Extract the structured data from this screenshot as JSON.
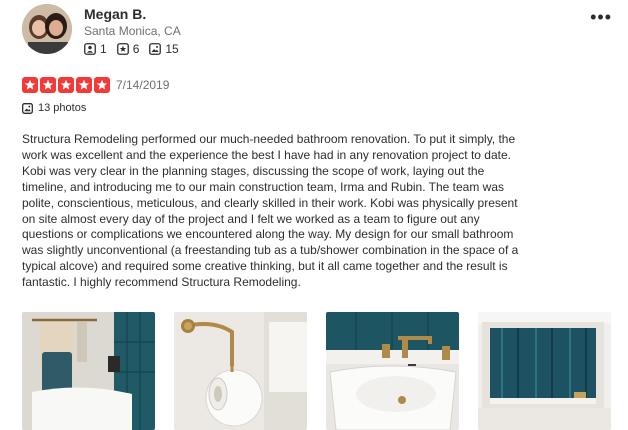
{
  "user": {
    "name": "Megan B.",
    "location": "Santa Monica, CA",
    "stats": {
      "friends": "1",
      "reviews": "6",
      "photos": "15"
    }
  },
  "review": {
    "rating": 5,
    "date": "7/14/2019",
    "photos_label": "13 photos",
    "text": "Structura Remodeling performed our much-needed bathroom renovation.  To put it simply, the work was excellent and the experience the best I have had in any renovation project to date.  Kobi was very clear in the planning stages, discussing the scope of work, laying out the timeline, and introducing me to our main construction team, Irma and Rubin.  The team was polite, conscientious, meticulous, and clearly skilled in their work.  Kobi was physically present on site almost every day of the project and I felt we worked as a team to figure out any questions or complications we encountered along the way.  My design for our small bathroom was slightly unconventional (a freestanding tub as a tub/shower combination in the space of a typical alcove) and required some creative thinking, but it all came together and the result is fantastic.  I highly recommend Structura Remodeling."
  },
  "icons": {
    "more": "more-options-icon",
    "friends": "friends-icon",
    "reviews": "reviews-icon",
    "photos": "photo-icon",
    "star": "star-icon"
  },
  "colors": {
    "star": "#f43939",
    "text": "#2d2d2d",
    "muted": "#6e7072",
    "tile": "#1b4f5a"
  }
}
